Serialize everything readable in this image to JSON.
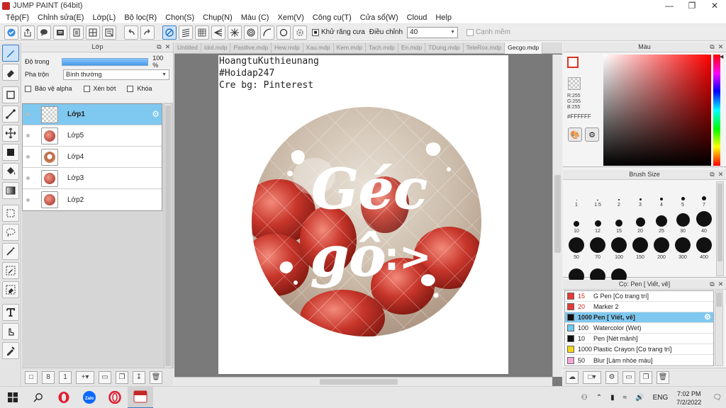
{
  "window": {
    "title": "JUMP PAINT (64bit)"
  },
  "menu": [
    "Tệp(F)",
    "Chỉnh sửa(E)",
    "Lớp(L)",
    "Bộ lọc(R)",
    "Chọn(S)",
    "Chụp(N)",
    "Màu (C)",
    "Xem(V)",
    "Công cụ(T)",
    "Cửa sổ(W)",
    "Cloud",
    "Help"
  ],
  "toolbar": {
    "antialias_label": "Khử răng cưa",
    "adjust_label": "Điều chỉnh",
    "adjust_value": "40",
    "snap_label": "Cạnh mềm"
  },
  "layer_panel": {
    "title": "Lớp",
    "opacity_label": "Độ trong",
    "opacity_value": "100 %",
    "opacity": 1.0,
    "blend_label": "Pha trộn",
    "blend_value": "Bình thường",
    "protect_alpha": "Bảo vệ alpha",
    "clipping": "Xén bớt",
    "lock": "Khóa",
    "layers": [
      "Lớp1",
      "Lớp5",
      "Lớp4",
      "Lớp3",
      "Lớp2"
    ]
  },
  "tabs": [
    "Untitled",
    "Idol.mdp",
    "Pastlive.mdp",
    "Hew.mdp",
    "Xau.mdp",
    "Kem.mdp",
    "Tach.mdp",
    "En.mdp",
    "TDung.mdp",
    "TeleRox.mdp",
    "Gecgo.mdp"
  ],
  "canvas": {
    "text_lines": [
      "HoangtuKuthieunang",
      "#Hoidap247",
      "Cre bg: Pinterest"
    ],
    "art_word1": "Géc",
    "art_word2": "gô",
    "art_emoticon": ":>"
  },
  "color_panel": {
    "title": "Màu",
    "r": "R:255",
    "g": "G:255",
    "b": "B:255",
    "hex": "#FFFFFF",
    "main_color": "#FFFFFF",
    "accent": "#DD3322"
  },
  "brush_panel": {
    "title": "Brush Size",
    "sizes": [
      "1",
      "1.5",
      "2",
      "3",
      "4",
      "5",
      "7",
      "10",
      "12",
      "15",
      "20",
      "25",
      "30",
      "40",
      "50",
      "70",
      "100",
      "150",
      "200",
      "300",
      "400",
      "",
      "",
      ""
    ]
  },
  "tool_list": {
    "title": "Cọ: Pen [ Viết, vẽ]",
    "items": [
      {
        "size": "15",
        "name": "G Pen [Cọ trang trí]",
        "color": "#E53935"
      },
      {
        "size": "20",
        "name": "Marker 2",
        "color": "#E53935"
      },
      {
        "size": "1000",
        "name": "Pen [ Viết, vẽ]",
        "color": "#111111"
      },
      {
        "size": "100",
        "name": "Watercolor (Wet)",
        "color": "#6EC8F0"
      },
      {
        "size": "10",
        "name": "Pen [Nét mảnh]",
        "color": "#111111"
      },
      {
        "size": "1000",
        "name": "Plastic Crayon [Cọ trang trí]",
        "color": "#F2D61E"
      },
      {
        "size": "50",
        "name": "Blur [Làm nhòe màu]",
        "color": "#F4A6D7"
      }
    ]
  },
  "taskbar": {
    "lang": "ENG",
    "time": "7:02 PM",
    "date": "7/2/2022"
  }
}
